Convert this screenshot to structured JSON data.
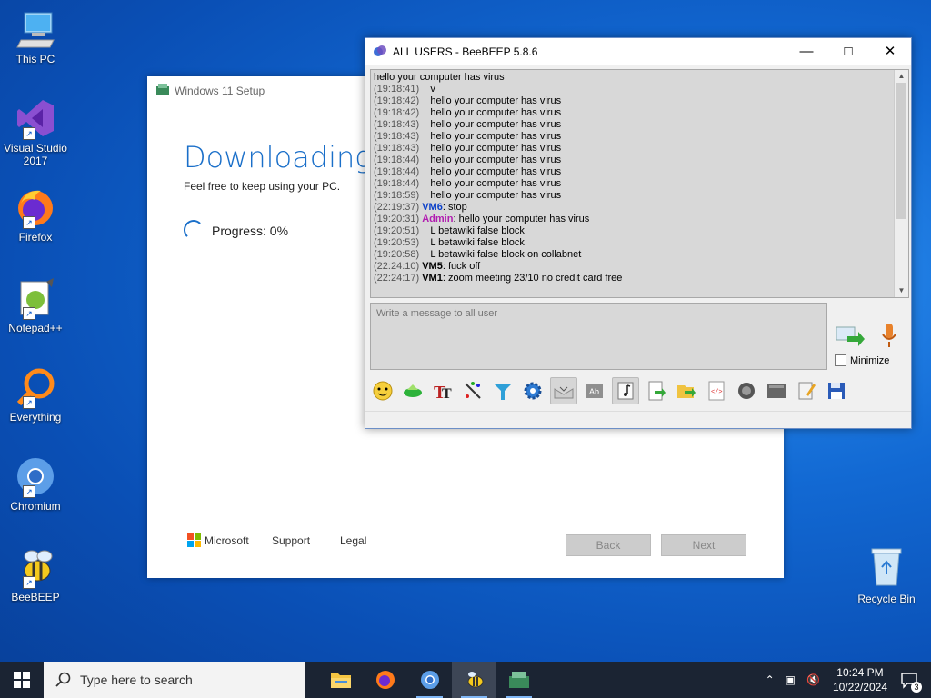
{
  "desktop": {
    "icons": [
      {
        "label": "This PC"
      },
      {
        "label": "Visual Studio 2017"
      },
      {
        "label": "Firefox"
      },
      {
        "label": "Notepad++"
      },
      {
        "label": "Everything"
      },
      {
        "label": "Chromium"
      },
      {
        "label": "BeeBEEP"
      }
    ],
    "recycle_bin": "Recycle Bin"
  },
  "setup": {
    "title": "Windows 11 Setup",
    "heading": "Downloading W",
    "subtitle": "Feel free to keep using your PC.",
    "progress_text": "Progress: 0%",
    "progress_value": 0,
    "microsoft": "Microsoft",
    "support": "Support",
    "legal": "Legal",
    "back": "Back",
    "next": "Next"
  },
  "chat": {
    "title": "ALL USERS - BeeBEEP 5.8.6",
    "messages": [
      {
        "ts": "",
        "user": "",
        "text": "hello your computer has virus"
      },
      {
        "ts": "(19:18:41)",
        "user": "",
        "text": "v"
      },
      {
        "ts": "(19:18:42)",
        "user": "",
        "text": "hello your computer has virus"
      },
      {
        "ts": "(19:18:42)",
        "user": "",
        "text": "hello your computer has virus"
      },
      {
        "ts": "(19:18:43)",
        "user": "",
        "text": "hello your computer has virus"
      },
      {
        "ts": "(19:18:43)",
        "user": "",
        "text": "hello your computer has virus"
      },
      {
        "ts": "(19:18:43)",
        "user": "",
        "text": "hello your computer has virus"
      },
      {
        "ts": "(19:18:44)",
        "user": "",
        "text": "hello your computer has virus"
      },
      {
        "ts": "(19:18:44)",
        "user": "",
        "text": "hello your computer has virus"
      },
      {
        "ts": "(19:18:44)",
        "user": "",
        "text": "hello your computer has virus"
      },
      {
        "ts": "(19:18:59)",
        "user": "",
        "text": "hello your computer has virus"
      },
      {
        "ts": "(22:19:37)",
        "user": "VM6",
        "user_style": "vm",
        "text": "stop"
      },
      {
        "ts": "(19:20:31)",
        "user": "Admin",
        "user_style": "admin",
        "text": "hello your computer has virus"
      },
      {
        "ts": "(19:20:51)",
        "user": "",
        "text": "L betawiki false block"
      },
      {
        "ts": "(19:20:53)",
        "user": "",
        "text": "L betawiki false block"
      },
      {
        "ts": "(19:20:58)",
        "user": "",
        "text": "L betawiki false block on collabnet"
      },
      {
        "ts": "(22:24:10)",
        "user": "VM5",
        "user_style": "bold",
        "text": "fuck off"
      },
      {
        "ts": "(22:24:17)",
        "user": "VM1",
        "user_style": "bold",
        "text": "zoom meeting 23/10 no credit card free"
      }
    ],
    "input_placeholder": "Write a message to all user",
    "minimize_label": "Minimize"
  },
  "taskbar": {
    "search_placeholder": "Type here to search",
    "time": "10:24 PM",
    "date": "10/22/2024",
    "notification_count": "3"
  }
}
